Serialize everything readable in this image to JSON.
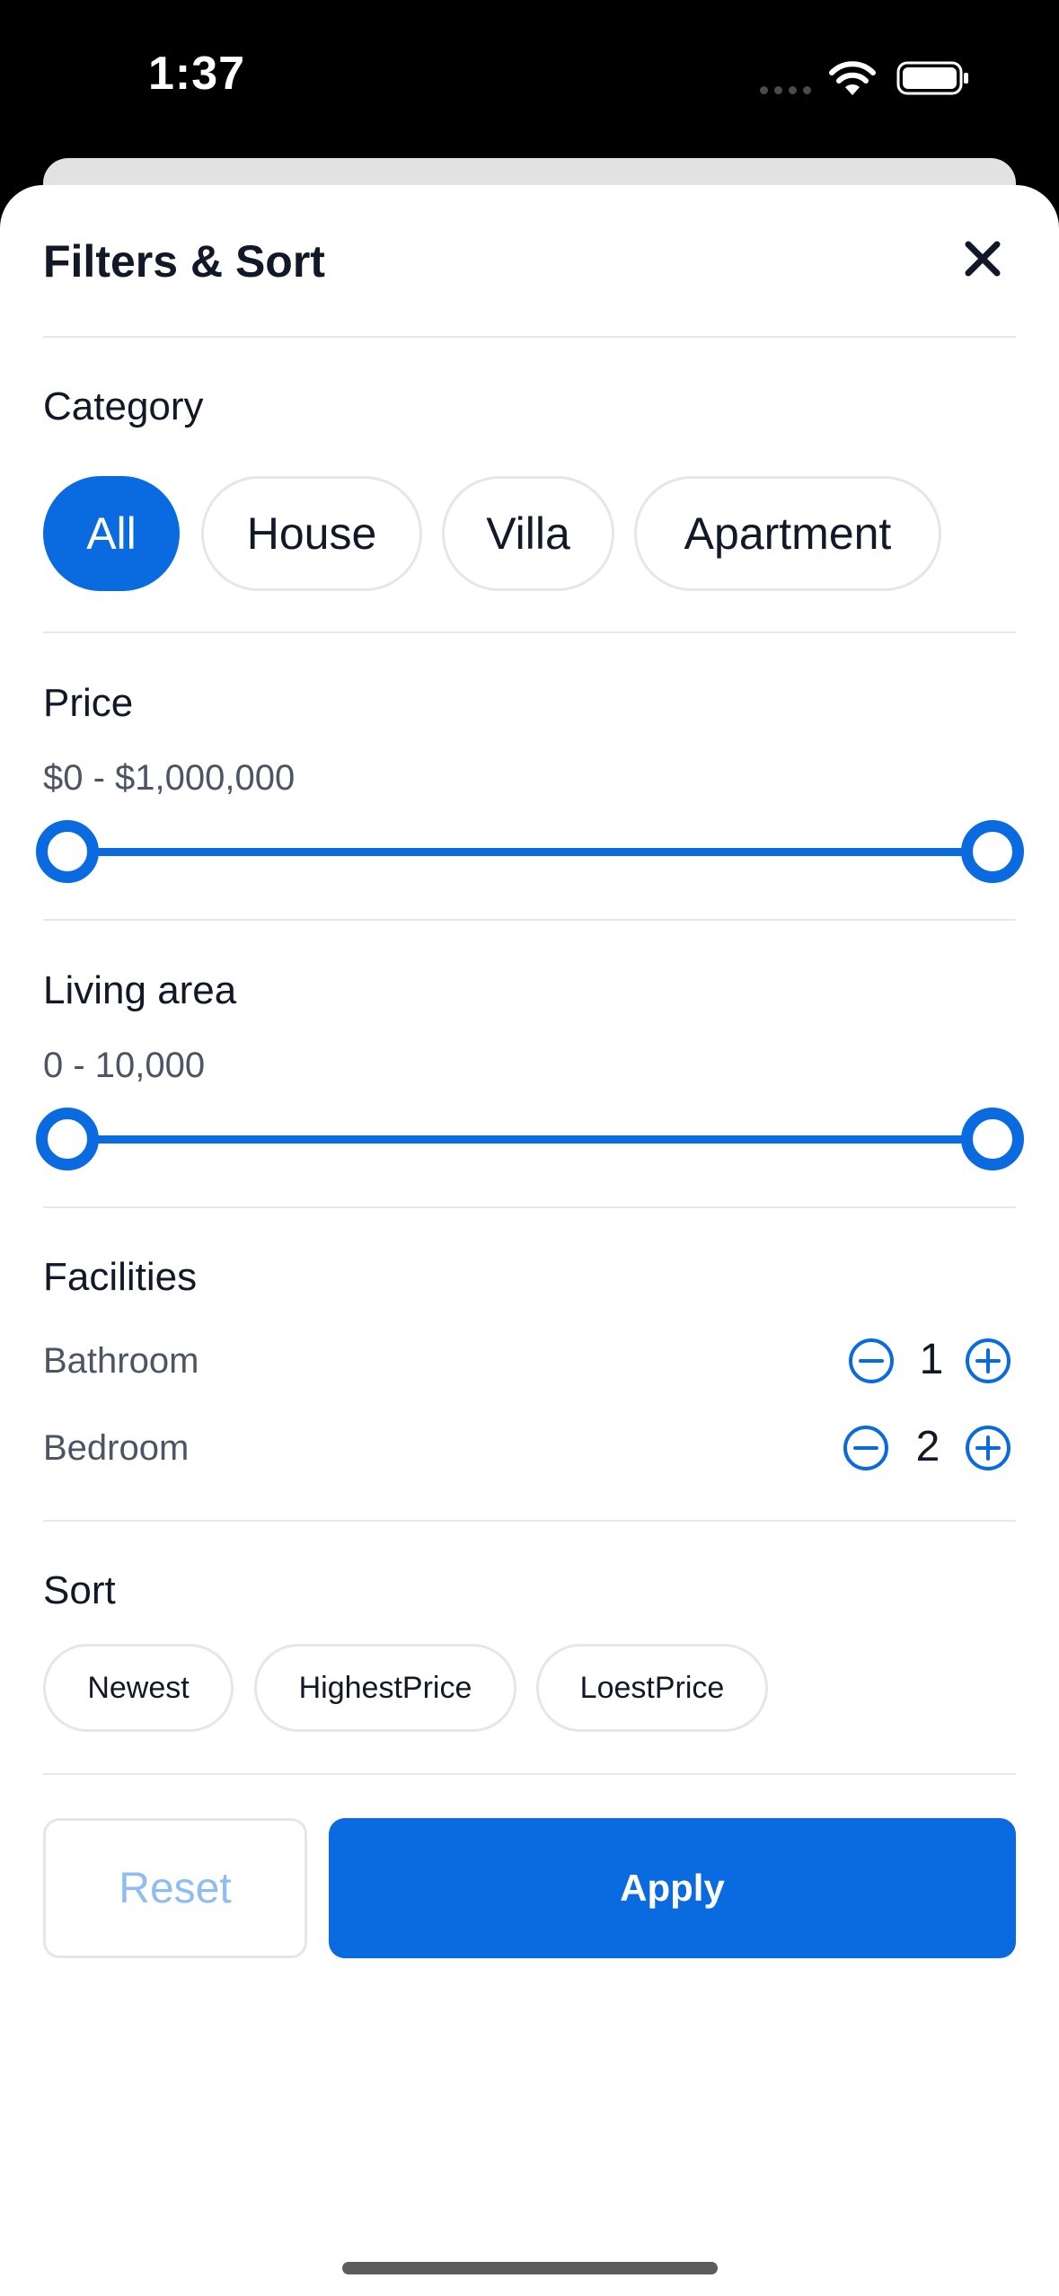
{
  "status_bar": {
    "time": "1:37",
    "wifi_icon": "wifi-icon",
    "battery_icon": "battery-icon"
  },
  "header": {
    "title": "Filters & Sort",
    "close_icon": "close-icon"
  },
  "category": {
    "title": "Category",
    "chips": [
      {
        "label": "All",
        "selected": true
      },
      {
        "label": "House",
        "selected": false
      },
      {
        "label": "Villa",
        "selected": false
      },
      {
        "label": "Apartment",
        "selected": false
      }
    ]
  },
  "price": {
    "title": "Price",
    "range_text": "$0 - $1,000,000",
    "min": 0,
    "max": 1000000,
    "low": 0,
    "high": 1000000
  },
  "living_area": {
    "title": "Living area",
    "range_text": "0 - 10,000",
    "min": 0,
    "max": 10000,
    "low": 0,
    "high": 10000
  },
  "facilities": {
    "title": "Facilities",
    "items": [
      {
        "label": "Bathroom",
        "value": "1"
      },
      {
        "label": "Bedroom",
        "value": "2"
      }
    ]
  },
  "sort": {
    "title": "Sort",
    "options": [
      "Newest",
      "HighestPrice",
      "LoestPrice"
    ]
  },
  "actions": {
    "reset_label": "Reset",
    "apply_label": "Apply"
  },
  "colors": {
    "accent": "#0a6be0",
    "reset_text": "#8fbdf2",
    "divider": "#e6e7ea"
  }
}
